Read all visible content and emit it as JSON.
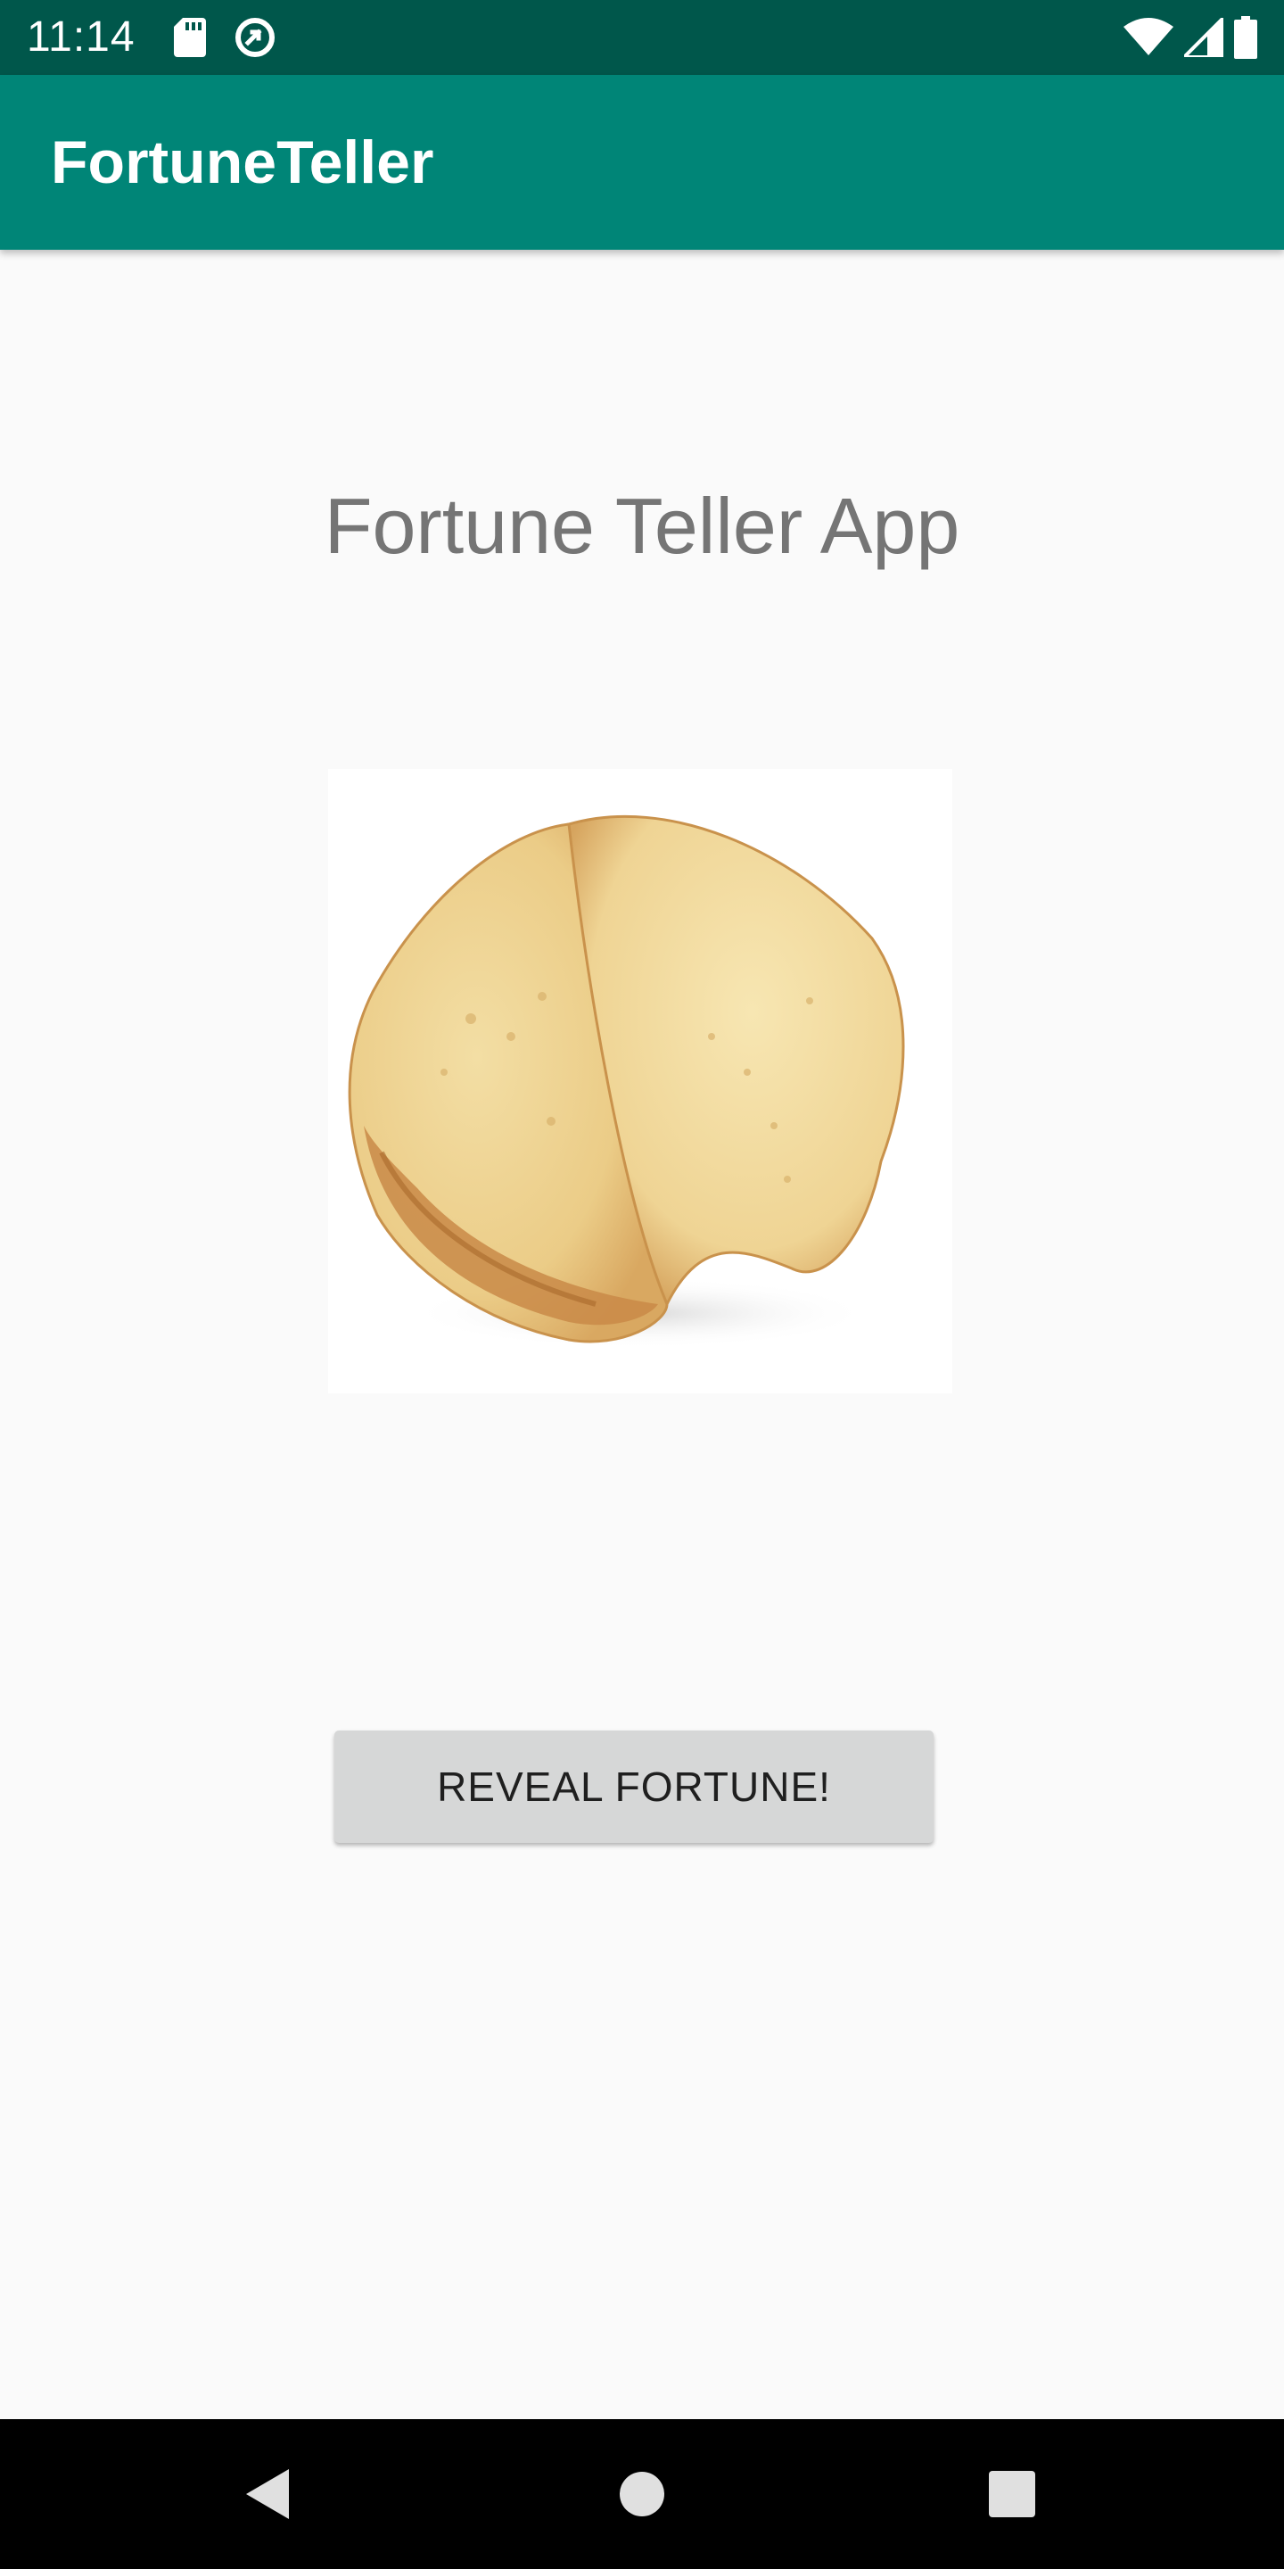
{
  "status_bar": {
    "time": "11:14",
    "left_icons": [
      "sd-card-icon",
      "sync-icon"
    ],
    "right_icons": [
      "wifi-icon",
      "signal-icon",
      "battery-icon"
    ],
    "color": "#00574b"
  },
  "app_bar": {
    "title": "FortuneTeller",
    "color": "#008577"
  },
  "main": {
    "heading": "Fortune Teller App",
    "image": "fortune-cookie-image",
    "button_label": "REVEAL FORTUNE!"
  },
  "nav_bar": {
    "buttons": [
      "back-icon",
      "home-icon",
      "recents-icon"
    ]
  }
}
